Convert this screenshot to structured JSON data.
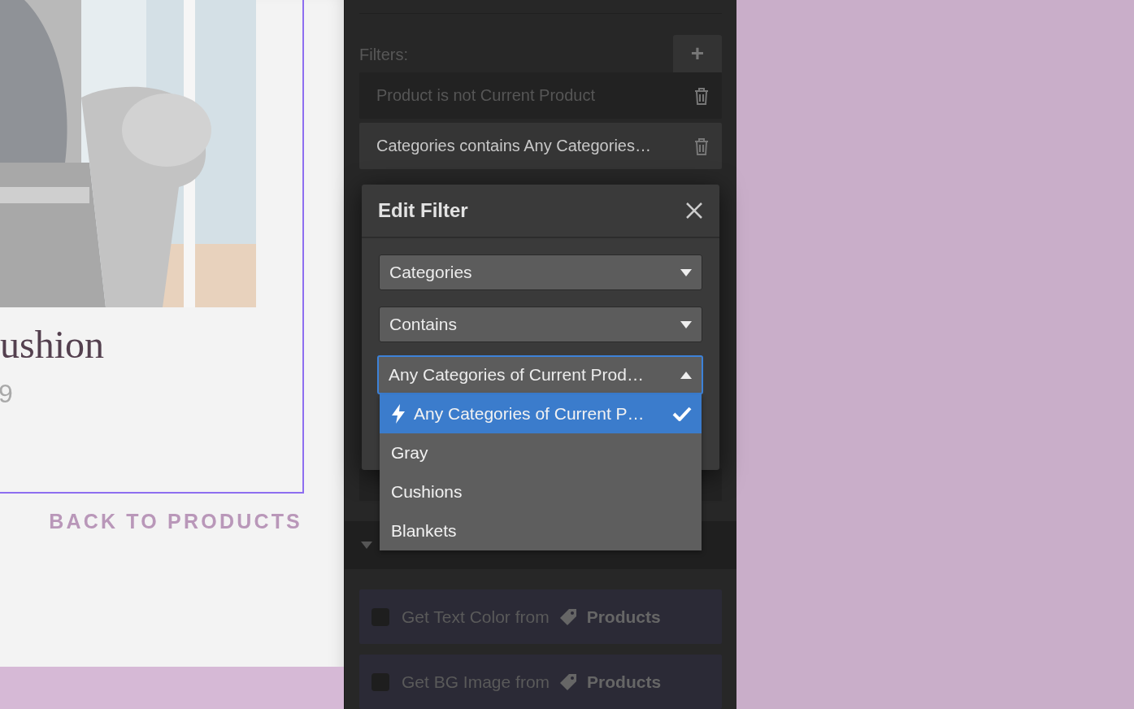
{
  "product_page": {
    "title": "ushion",
    "price": "9",
    "back_link": "BACK TO PRODUCTS"
  },
  "panel": {
    "filters_label": "Filters:",
    "add_button": "+",
    "filters": [
      {
        "text": "Product is not Current Product",
        "selected": false
      },
      {
        "text": "Categories contains Any Categories…",
        "selected": true
      }
    ],
    "checkbox_rows": [
      {
        "label": "Get Text Color from",
        "source": "Products",
        "checked": false
      },
      {
        "label": "Get BG Image from",
        "source": "Products",
        "checked": false
      }
    ]
  },
  "edit_filter": {
    "title": "Edit Filter",
    "selects": [
      {
        "value": "Categories",
        "open": false
      },
      {
        "value": "Contains",
        "open": false
      },
      {
        "value": "Any Categories of Current Prod…",
        "open": true
      }
    ],
    "options": [
      {
        "label": "Any Categories of Current P…",
        "kind": "dynamic",
        "selected": true
      },
      {
        "label": "Gray",
        "kind": "static",
        "selected": false
      },
      {
        "label": "Cushions",
        "kind": "static",
        "selected": false
      },
      {
        "label": "Blankets",
        "kind": "static",
        "selected": false
      }
    ]
  }
}
